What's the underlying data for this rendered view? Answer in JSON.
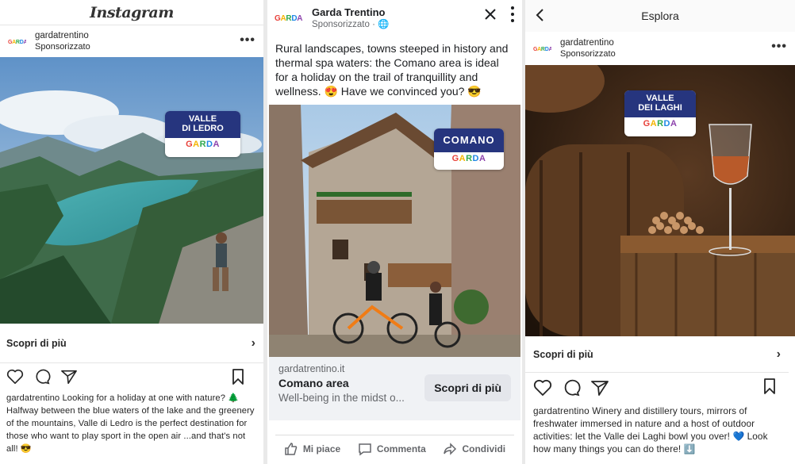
{
  "instagram": {
    "app_title": "Instagram",
    "account": "gardatrentino",
    "sponsored": "Sponsorizzato",
    "badge_line1": "VALLE",
    "badge_line2": "DI LEDRO",
    "brand": "GARDA",
    "brand_sub": "TRENTINO",
    "cta": "Scopri di più",
    "caption_user": "gardatrentino",
    "caption": "Looking for a holiday at one with nature? 🌲 Halfway between the blue waters of the lake and the greenery of the mountains, Valle di Ledro is the perfect destination for those who want to play sport in the open air ...and that's not all! 😎"
  },
  "facebook": {
    "page_name": "Garda Trentino",
    "sponsored": "Sponsorizzato · 🌐",
    "brand": "GARDA",
    "brand_sub": "TRENTINO",
    "post_text": "Rural landscapes, towns steeped in history and thermal spa waters: the Comano area is ideal for a holiday on the trail of tranquillity and wellness. 😍 Have we convinced you? 😎",
    "badge": "COMANO",
    "link_domain": "gardatrentino.it",
    "link_title": "Comano area",
    "link_desc": "Well-being in the midst o...",
    "cta": "Scopri di più",
    "like": "Mi piace",
    "comment": "Commenta",
    "share": "Condividi"
  },
  "explore": {
    "title": "Esplora",
    "account": "gardatrentino",
    "sponsored": "Sponsorizzato",
    "badge_line1": "VALLE",
    "badge_line2": "DEI LAGHI",
    "brand": "GARDA",
    "brand_sub": "TRENTINO",
    "cta": "Scopri di più",
    "caption_user": "gardatrentino",
    "caption": "Winery and distillery tours, mirrors of freshwater immersed in nature and a host of outdoor activities: let the Valle dei Laghi bowl you over! 💙 Look how many things you can do there! ⬇️"
  },
  "colors": {
    "badge_blue": "#26357e",
    "fb_gray": "#f0f2f5"
  }
}
